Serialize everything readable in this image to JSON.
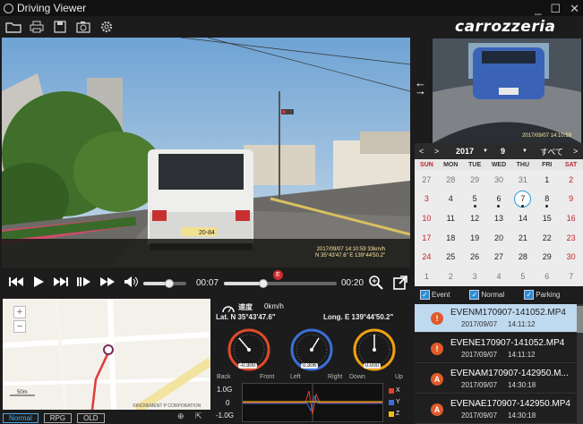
{
  "window": {
    "title": "Driving Viewer",
    "brand": "carrozzeria",
    "buttons": [
      "_",
      "☐",
      "✕"
    ]
  },
  "toolbar": {
    "icons": [
      "open-folder-icon",
      "print-icon",
      "save-icon",
      "camera-icon",
      "settings-icon"
    ]
  },
  "video": {
    "overlay_line1": "2017/09/07 14:10:59 33km/h",
    "overlay_line2": "N 35°43'47.6\" E 139°44'50.2\"",
    "plate": "20-84"
  },
  "player": {
    "current_time": "00:07",
    "end_time": "00:20",
    "event_marker": "E",
    "progress": 0.35,
    "volume": 0.6
  },
  "side_video": {
    "overlay": "2017/09/07 14:10:59"
  },
  "calendar": {
    "year": "2017",
    "month": "9",
    "all_label": "すべて",
    "weekdays": [
      "SUN",
      "MON",
      "TUE",
      "WED",
      "THU",
      "FRI",
      "SAT"
    ],
    "weeks": [
      [
        "27",
        "28",
        "29",
        "30",
        "31",
        "1",
        "2"
      ],
      [
        "3",
        "4",
        "5",
        "6",
        "7",
        "8",
        "9"
      ],
      [
        "10",
        "11",
        "12",
        "13",
        "14",
        "15",
        "16"
      ],
      [
        "17",
        "18",
        "19",
        "20",
        "21",
        "22",
        "23"
      ],
      [
        "24",
        "25",
        "26",
        "27",
        "28",
        "29",
        "30"
      ],
      [
        "1",
        "2",
        "3",
        "4",
        "5",
        "6",
        "7"
      ]
    ],
    "selected_day": "7"
  },
  "filters": [
    {
      "label": "Event",
      "checked": true
    },
    {
      "label": "Normal",
      "checked": true
    },
    {
      "label": "Parking",
      "checked": true
    }
  ],
  "files": [
    {
      "name": "EVENM170907-141052.MP4",
      "date": "2017/09/07",
      "time": "14:11:12",
      "badge": "!",
      "selected": true
    },
    {
      "name": "EVENE170907-141052.MP4",
      "date": "2017/09/07",
      "time": "14:11:12",
      "badge": "!",
      "selected": false
    },
    {
      "name": "EVENAM170907-142950.M...",
      "date": "2017/09/07",
      "time": "14:30:18",
      "badge": "A",
      "selected": false
    },
    {
      "name": "EVENAE170907-142950.MP4",
      "date": "2017/09/07",
      "time": "14:30:18",
      "badge": "A",
      "selected": false
    }
  ],
  "map": {
    "scale": "50m",
    "copyright": "©INCREMENT P CORPORATION",
    "tabs": [
      "Normal",
      "RPG",
      "OLD"
    ],
    "active_tab": "Normal"
  },
  "telemetry": {
    "speed_label": "速度",
    "speed_value": "0km/h",
    "lat": "Lat. N 35°43'47.6\"",
    "long": "Long. E 139°44'50.2\"",
    "gauges": [
      {
        "value": "-0.300",
        "color": "#e04a2a",
        "labels": [
          "Back",
          "Front"
        ]
      },
      {
        "value": "0.306",
        "color": "#3a6fd8",
        "labels": [
          "Left",
          "Right"
        ]
      },
      {
        "value": "0.000",
        "color": "#f0a010",
        "labels": [
          "Down",
          "Up"
        ]
      }
    ],
    "g_axis": [
      "1.0G",
      "0",
      "-1.0G"
    ],
    "legend": [
      {
        "name": "X",
        "color": "#e0402a"
      },
      {
        "name": "Y",
        "color": "#3a6fd8"
      },
      {
        "name": "Z",
        "color": "#f0c010"
      }
    ]
  },
  "colors": {
    "accent": "#2a9bd5",
    "sunday": "#c0242a",
    "event": "#e05a2a"
  }
}
